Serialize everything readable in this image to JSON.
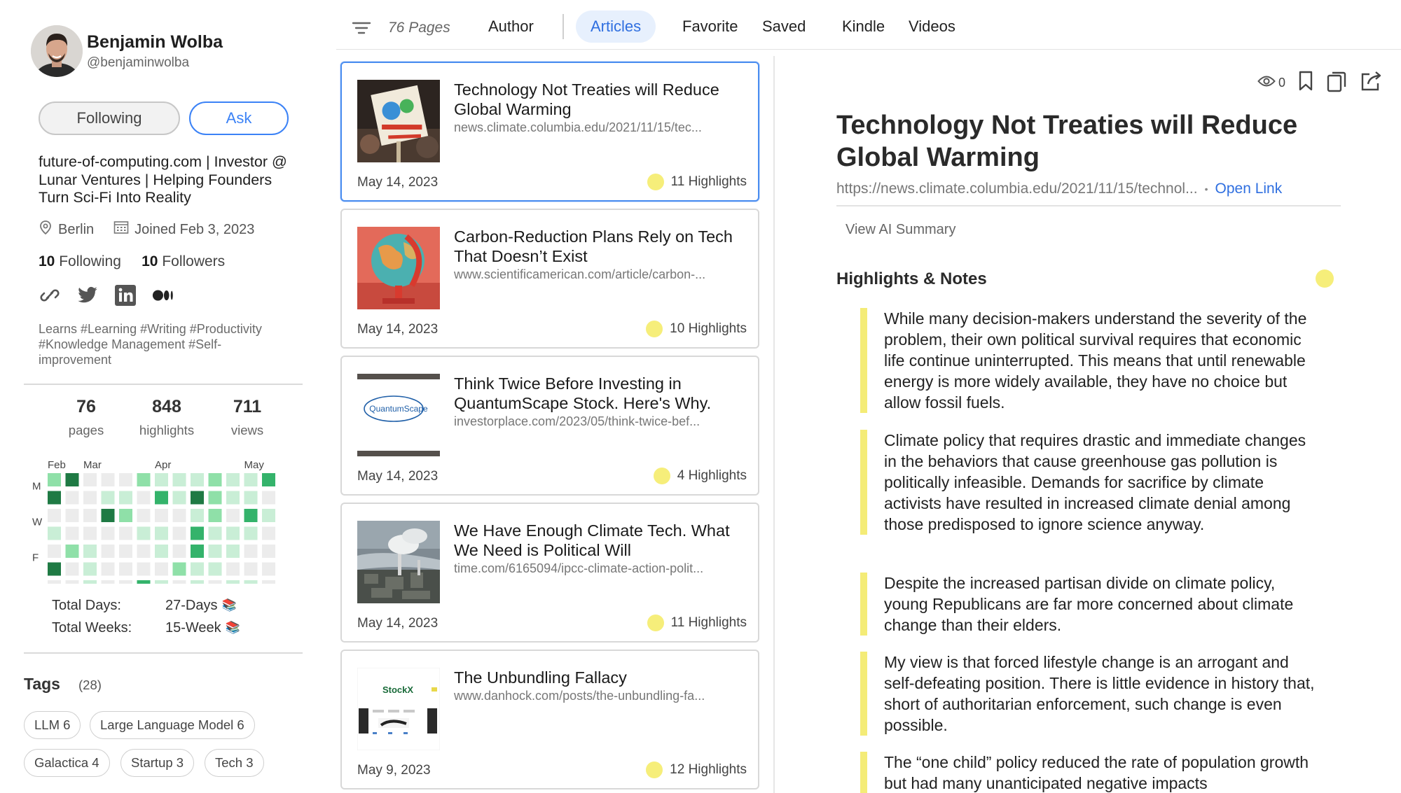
{
  "profile": {
    "name": "Benjamin Wolba",
    "handle": "@benjaminwolba",
    "following_btn": "Following",
    "ask_btn": "Ask",
    "bio": "future-of-computing.com | Investor @ Lunar Ventures | Helping Founders Turn Sci-Fi Into Reality",
    "location": "Berlin",
    "joined": "Joined Feb 3, 2023",
    "following_count": "10",
    "following_label": "Following",
    "followers_count": "10",
    "followers_label": "Followers",
    "socials": [
      "link-icon",
      "twitter-icon",
      "linkedin-icon",
      "medium-icon"
    ],
    "interests": "Learns #Learning #Writing #Productivity #Knowledge Management #Self-improvement"
  },
  "stats": [
    {
      "num": "76",
      "label": "pages"
    },
    {
      "num": "848",
      "label": "highlights"
    },
    {
      "num": "711",
      "label": "views"
    }
  ],
  "heatmap": {
    "months": [
      "Feb",
      "Mar",
      "Apr",
      "May"
    ],
    "days": [
      "M",
      "W",
      "F"
    ],
    "columns": 13,
    "rows": 7,
    "cells": [
      [
        0,
        0,
        2
      ],
      [
        0,
        1,
        4
      ],
      [
        0,
        5,
        2
      ],
      [
        0,
        6,
        1
      ],
      [
        0,
        7,
        1
      ],
      [
        0,
        8,
        1
      ],
      [
        0,
        9,
        2
      ],
      [
        0,
        10,
        1
      ],
      [
        0,
        11,
        1
      ],
      [
        0,
        12,
        3
      ],
      [
        1,
        0,
        4
      ],
      [
        1,
        3,
        1
      ],
      [
        1,
        4,
        1
      ],
      [
        1,
        6,
        3
      ],
      [
        1,
        7,
        1
      ],
      [
        1,
        8,
        4
      ],
      [
        1,
        9,
        2
      ],
      [
        1,
        10,
        1
      ],
      [
        1,
        11,
        1
      ],
      [
        2,
        3,
        4
      ],
      [
        2,
        4,
        2
      ],
      [
        2,
        8,
        1
      ],
      [
        2,
        9,
        2
      ],
      [
        2,
        11,
        3
      ],
      [
        2,
        12,
        1
      ],
      [
        3,
        0,
        1
      ],
      [
        3,
        5,
        1
      ],
      [
        3,
        6,
        1
      ],
      [
        3,
        8,
        3
      ],
      [
        3,
        9,
        1
      ],
      [
        3,
        10,
        1
      ],
      [
        3,
        11,
        1
      ],
      [
        4,
        1,
        2
      ],
      [
        4,
        2,
        1
      ],
      [
        4,
        6,
        1
      ],
      [
        4,
        8,
        3
      ],
      [
        4,
        9,
        1
      ],
      [
        4,
        10,
        1
      ],
      [
        5,
        0,
        4
      ],
      [
        5,
        2,
        1
      ],
      [
        5,
        7,
        2
      ],
      [
        5,
        8,
        1
      ],
      [
        5,
        9,
        1
      ],
      [
        6,
        2,
        1
      ],
      [
        6,
        5,
        3
      ],
      [
        6,
        6,
        1
      ],
      [
        6,
        8,
        1
      ],
      [
        6,
        10,
        1
      ],
      [
        6,
        11,
        1
      ]
    ],
    "colors": [
      "#ececec",
      "#c9eed6",
      "#8fe0a8",
      "#34b36b",
      "#1f7a44"
    ]
  },
  "totals": {
    "days_label": "Total Days:",
    "days_value": "27-Days",
    "weeks_label": "Total Weeks:",
    "weeks_value": "15-Week"
  },
  "tags": {
    "title": "Tags",
    "count": "(28)",
    "items": [
      "LLM 6",
      "Large Language Model 6",
      "Galactica 4",
      "Startup 3",
      "Tech 3"
    ]
  },
  "nav": {
    "pages": "76 Pages",
    "tabs": [
      "Author",
      "Articles",
      "Favorite",
      "Saved",
      "Kindle",
      "Videos"
    ],
    "active": "Articles"
  },
  "articles": [
    {
      "title": "Technology Not Treaties will Reduce Global Warming",
      "url": "news.climate.columbia.edu/2021/11/15/tec...",
      "date": "May 14, 2023",
      "highlights": "11 Highlights"
    },
    {
      "title": "Carbon-Reduction Plans Rely on Tech That Doesn’t Exist",
      "url": "www.scientificamerican.com/article/carbon-...",
      "date": "May 14, 2023",
      "highlights": "10 Highlights"
    },
    {
      "title": "Think Twice Before Investing in QuantumScape Stock. Here's Why.",
      "url": "investorplace.com/2023/05/think-twice-bef...",
      "date": "May 14, 2023",
      "highlights": "4 Highlights",
      "thumb_text": "QuantumScape"
    },
    {
      "title": "We Have Enough Climate Tech. What We Need is Political Will",
      "url": "time.com/6165094/ipcc-climate-action-polit...",
      "date": "May 14, 2023",
      "highlights": "11 Highlights"
    },
    {
      "title": "The Unbundling Fallacy",
      "url": "www.danhock.com/posts/the-unbundling-fa...",
      "date": "May 9, 2023",
      "highlights": "12 Highlights",
      "thumb_text": "StockX"
    }
  ],
  "detail": {
    "views": "0",
    "title": "Technology Not Treaties will Reduce Global Warming",
    "url": "https://news.climate.columbia.edu/2021/11/15/technol...",
    "sep": "•",
    "open_link": "Open Link",
    "ai_summary": "View AI Summary",
    "highlights_title": "Highlights & Notes",
    "highlight_color": "#f6ee7a",
    "quotes": [
      "While many decision-makers understand the severity of the problem, their own political survival requires that economic life continue uninterrupted. This means that until renewable energy is more widely available, they have no choice but allow fossil fuels.",
      "Climate policy that requires drastic and immediate changes in the behaviors that cause greenhouse gas pollution is politically infeasible. Demands for sacrifice by climate activists have resulted in increased climate denial among those predisposed to ignore science anyway.",
      "Despite the increased partisan divide on climate policy, young Republicans are far more concerned about climate change than their elders.",
      "My view is that forced lifestyle change is an arrogant and self-defeating position. There is little evidence in history that, short of authoritarian enforcement, such change is even possible.",
      "The “one child” policy reduced the rate of population growth but had many unanticipated negative impacts"
    ]
  }
}
